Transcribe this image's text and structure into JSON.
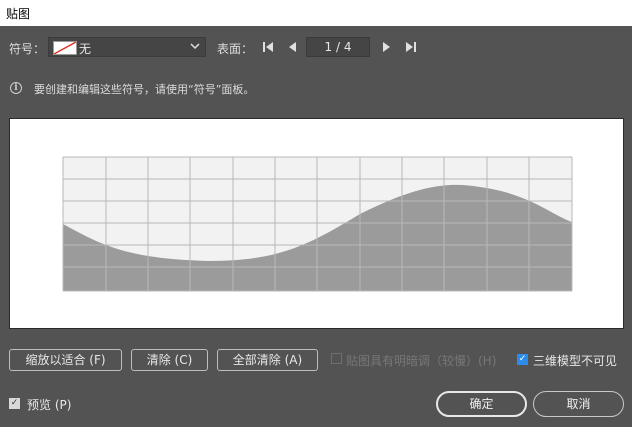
{
  "window": {
    "title": "贴图"
  },
  "symbol": {
    "label": "符号：",
    "selected": "无"
  },
  "surface": {
    "label": "表面：",
    "page_display": "1 / 4"
  },
  "info": {
    "text": "要创建和编辑这些符号，请使用“符号”面板。"
  },
  "buttons": {
    "fit": "缩放以适合 (F)",
    "clear": "清除 (C)",
    "clear_all": "全部清除 (A)",
    "ok": "确定",
    "cancel": "取消"
  },
  "options": {
    "invisible_geometry": {
      "label": "贴图具有明暗调（较慢）(H)",
      "checked": false,
      "enabled": false
    },
    "three_d_invisible": {
      "label": "三维模型不可见",
      "checked": true
    },
    "preview": {
      "label": "预览 (P)",
      "checked": true
    }
  },
  "colors": {
    "background": "#535353",
    "checkbox_accent": "#2d8ceb",
    "surface_fill": "#9b9b9b",
    "grid_line": "#b8b8b8",
    "grid_bg": "#f2f2f2"
  }
}
